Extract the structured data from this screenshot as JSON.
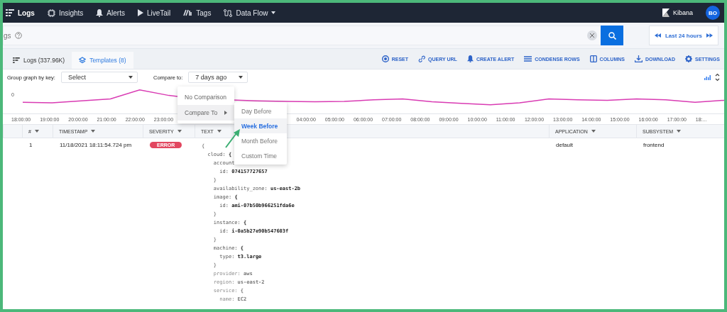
{
  "nav": {
    "items": [
      {
        "label": "Logs",
        "selected": true
      },
      {
        "label": "Insights",
        "selected": false
      },
      {
        "label": "Alerts",
        "selected": false
      },
      {
        "label": "LiveTail",
        "selected": false
      },
      {
        "label": "Tags",
        "selected": false
      },
      {
        "label": "Data Flow",
        "selected": false,
        "dropdown": true
      }
    ],
    "brand": "Kibana",
    "avatar": "BO"
  },
  "search": {
    "placeholder": "gs",
    "time_range": "Last 24 hours"
  },
  "tabs": [
    {
      "label": "Logs (337.96K)",
      "selected": false
    },
    {
      "label": "Templates (8)",
      "selected": true
    }
  ],
  "actions": [
    "RESET",
    "QUERY URL",
    "CREATE ALERT",
    "CONDENSE ROWS",
    "COLUMNS",
    "DOWNLOAD",
    "SETTINGS"
  ],
  "controls": {
    "group_label": "Group graph by key:",
    "group_value": "Select",
    "compare_label": "Compare to:",
    "compare_value": "7 days ago"
  },
  "chart": {
    "y_label": "0",
    "x_labels_left": [
      "18:00:00",
      "19:00:00",
      "20:00:00",
      "21:00:00",
      "22:00:00",
      "23:00:00"
    ],
    "x_labels_right": [
      "04:00:00",
      "05:00:00",
      "06:00:00",
      "07:00:00",
      "08:00:00",
      "09:00:00",
      "10:00:00",
      "11:00:00",
      "12:00:00",
      "13:00:00",
      "14:00:00",
      "15:00:00",
      "16:00:00",
      "17:00:00",
      "18:..."
    ]
  },
  "menu": {
    "items": [
      {
        "label": "No Comparison",
        "highlighted": false,
        "submenu": false
      },
      {
        "label": "Compare To",
        "highlighted": true,
        "submenu": true
      }
    ],
    "submenu": [
      {
        "label": "Day Before",
        "selected": false
      },
      {
        "label": "Week Before",
        "selected": true
      },
      {
        "label": "Month Before",
        "selected": false
      },
      {
        "label": "Custom Time",
        "selected": false
      }
    ]
  },
  "table": {
    "columns": [
      "#",
      "TIMESTAMP",
      "SEVERITY",
      "TEXT",
      "APPLICATION",
      "SUBSYSTEM"
    ],
    "rows": [
      {
        "number": "1",
        "timestamp": "11/18/2021 18:11:54.724 pm",
        "severity": "ERROR",
        "application": "default",
        "subsystem": "frontend",
        "text": [
          {
            "value": "{",
            "children": [
              {
                "key": "cloud:",
                "value": "{",
                "children": [
                  {
                    "key": "account",
                    "children": [
                      {
                        "key": "id:",
                        "value": "074157727657"
                      }
                    ]
                  },
                  {
                    "value": "}"
                  },
                  {
                    "key": "availability_zone:",
                    "value": "us-east-2b"
                  },
                  {
                    "key": "image:",
                    "value": "{",
                    "children": [
                      {
                        "key": "id:",
                        "value": "ami-07b50b966251fda6e"
                      }
                    ]
                  },
                  {
                    "value": "}"
                  },
                  {
                    "key": "instance:",
                    "value": "{",
                    "children": [
                      {
                        "key": "id:",
                        "value": "i-0a5b27e90b547603f"
                      }
                    ]
                  },
                  {
                    "value": "}"
                  },
                  {
                    "key": "machine:",
                    "value": "{",
                    "children": [
                      {
                        "key": "type:",
                        "value": "t3.large"
                      }
                    ]
                  },
                  {
                    "value": "}"
                  },
                  {
                    "key": "provider:",
                    "value": "aws",
                    "faded": true
                  },
                  {
                    "key": "region:",
                    "value": "us-east-2",
                    "faded": true
                  },
                  {
                    "key": "service:",
                    "value": "{",
                    "faded": true,
                    "children": [
                      {
                        "key": "name:",
                        "value": "EC2",
                        "faded": true
                      }
                    ]
                  }
                ]
              }
            ]
          }
        ]
      }
    ]
  }
}
